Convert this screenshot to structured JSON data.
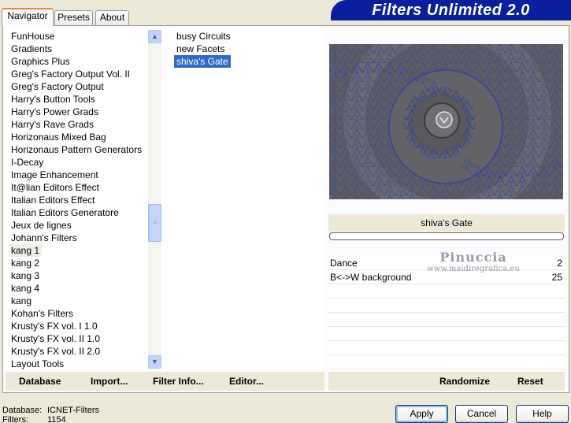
{
  "tabs": [
    "Navigator",
    "Presets",
    "About"
  ],
  "app_title": "Filters Unlimited 2.0",
  "categories": [
    "FunHouse",
    "Gradients",
    "Graphics Plus",
    "Greg's Factory Output Vol. II",
    "Greg's Factory Output",
    "Harry's Button Tools",
    "Harry's Power Grads",
    "Harry's Rave Grads",
    "Horizonaus Mixed Bag",
    "Horizonaus Pattern Generators",
    "I-Decay",
    "Image Enhancement",
    "It@lian Editors Effect",
    "Italian Editors Effect",
    "Italian Editors Generatore",
    "Jeux de lignes",
    "Johann's Filters",
    "kang 1",
    "kang 2",
    "kang 3",
    "kang 4",
    "kang",
    "Kohan's Filters",
    "Krusty's FX vol. I 1.0",
    "Krusty's FX vol. II 1.0",
    "Krusty's FX vol. II 2.0",
    "Layout Tools"
  ],
  "selected_category": "kang 1",
  "filters": [
    "busy Circuits",
    "new Facets",
    "shiva's Gate"
  ],
  "selected_filter": "shiva's Gate",
  "filter_name": "shiva's Gate",
  "params": [
    {
      "label": "Dance",
      "value": "2"
    },
    {
      "label": "B<->W background",
      "value": "25"
    }
  ],
  "watermark": {
    "line1": "Pinuccia",
    "line2": "www.maidiregrafica.eu"
  },
  "left_buttons": [
    "Database",
    "Import...",
    "Filter Info...",
    "Editor..."
  ],
  "right_buttons": [
    "Randomize",
    "Reset"
  ],
  "footer": {
    "database_label": "Database:",
    "database_value": "ICNET-Filters",
    "filters_label": "Filters:",
    "filters_value": "1154"
  },
  "dialog_buttons": [
    "Apply",
    "Cancel",
    "Help"
  ],
  "colors": {
    "accent": "#316ac5",
    "banner": "#0a1f9c",
    "tab_highlight": "#e68b2c"
  },
  "icons": {
    "scroll_up": "chevron-up-icon",
    "scroll_down": "chevron-down-icon",
    "thumb": "grip-icon"
  }
}
